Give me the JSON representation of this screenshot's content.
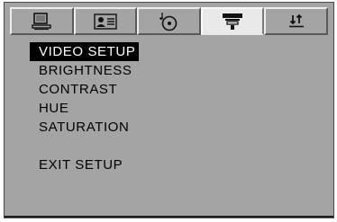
{
  "tabs": [
    {
      "icon": "monitor-icon",
      "active": false
    },
    {
      "icon": "audio-language-icon",
      "active": false
    },
    {
      "icon": "disc-music-icon",
      "active": false
    },
    {
      "icon": "video-setup-icon",
      "active": true
    },
    {
      "icon": "preferences-arrows-icon",
      "active": false
    }
  ],
  "menu": {
    "title": "VIDEO SETUP",
    "items": [
      "BRIGHTNESS",
      "CONTRAST",
      "HUE",
      "SATURATION"
    ],
    "exit": "EXIT SETUP"
  },
  "colors": {
    "panel": "#a4a4a4",
    "active_tab": "#e9e9e9",
    "selection": "#000000",
    "text": "#000000"
  }
}
